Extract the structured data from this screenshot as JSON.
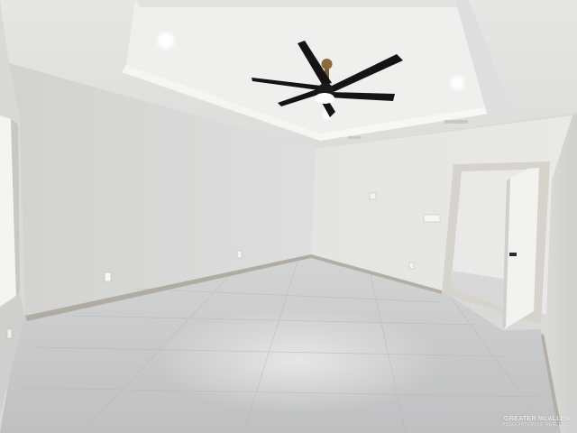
{
  "photo": {
    "subject": "empty-bedroom",
    "palette": {
      "ceiling": "#e9e9e7",
      "tray_ceiling": "#eeeeec",
      "left_wall": "#dcdcda",
      "back_wall": "#e5e5e3",
      "right_wall": "#d7d7d5",
      "floor": "#c9cacb",
      "baseboard": "#aeaaa2",
      "fan_blade": "#141414",
      "fan_bronze": "#8a6a3a",
      "door_frame": "#cfcbc3"
    }
  },
  "watermark": {
    "line1": "GREATER McALLEN",
    "line2": "ASSOCIATION OF REALTORS"
  }
}
